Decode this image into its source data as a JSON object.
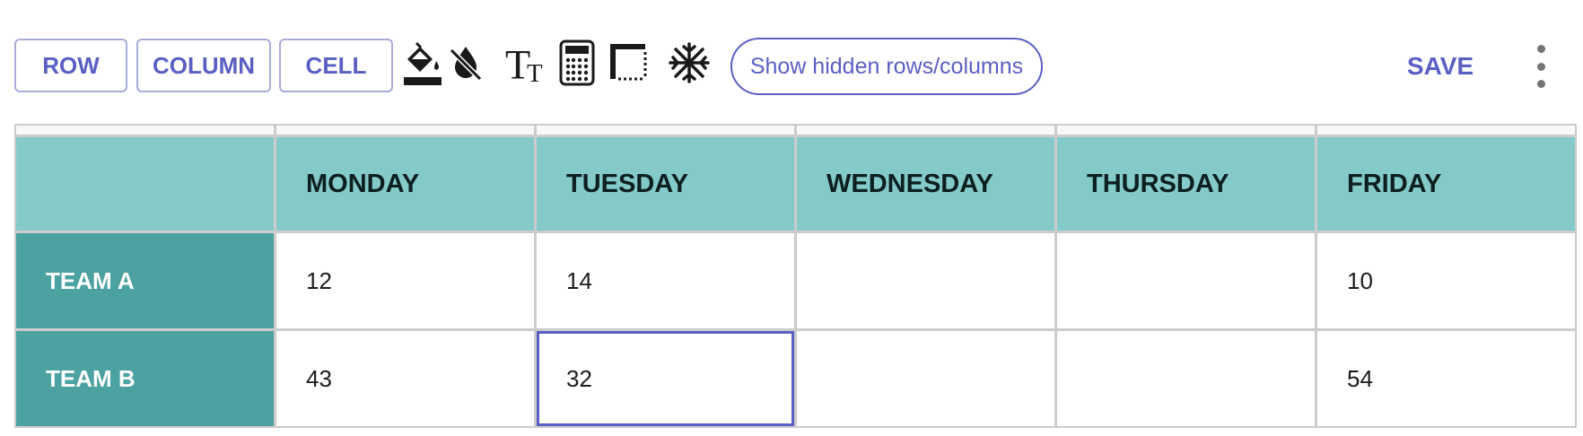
{
  "toolbar": {
    "row_label": "ROW",
    "column_label": "COLUMN",
    "cell_label": "CELL",
    "show_hidden_label": "Show hidden rows/columns",
    "save_label": "SAVE",
    "icons": [
      "paint-bucket-icon",
      "no-color-icon",
      "text-size-icon",
      "calculator-icon",
      "border-icon",
      "freeze-icon",
      "more-vert-icon"
    ]
  },
  "table": {
    "columns": [
      "",
      "MONDAY",
      "TUESDAY",
      "WEDNESDAY",
      "THURSDAY",
      "FRIDAY"
    ],
    "rows": [
      {
        "label": "TEAM A",
        "cells": [
          "12",
          "14",
          "",
          "",
          "10"
        ]
      },
      {
        "label": "TEAM B",
        "cells": [
          "43",
          "32",
          "",
          "",
          "54"
        ]
      }
    ],
    "selected_cell": {
      "row": "TEAM B",
      "column": "TUESDAY"
    }
  },
  "colors": {
    "accent": "#5a5fc3",
    "header_bg": "#83cac8",
    "row_header_bg": "#4ca1a1",
    "grid_line": "#cccccc"
  }
}
